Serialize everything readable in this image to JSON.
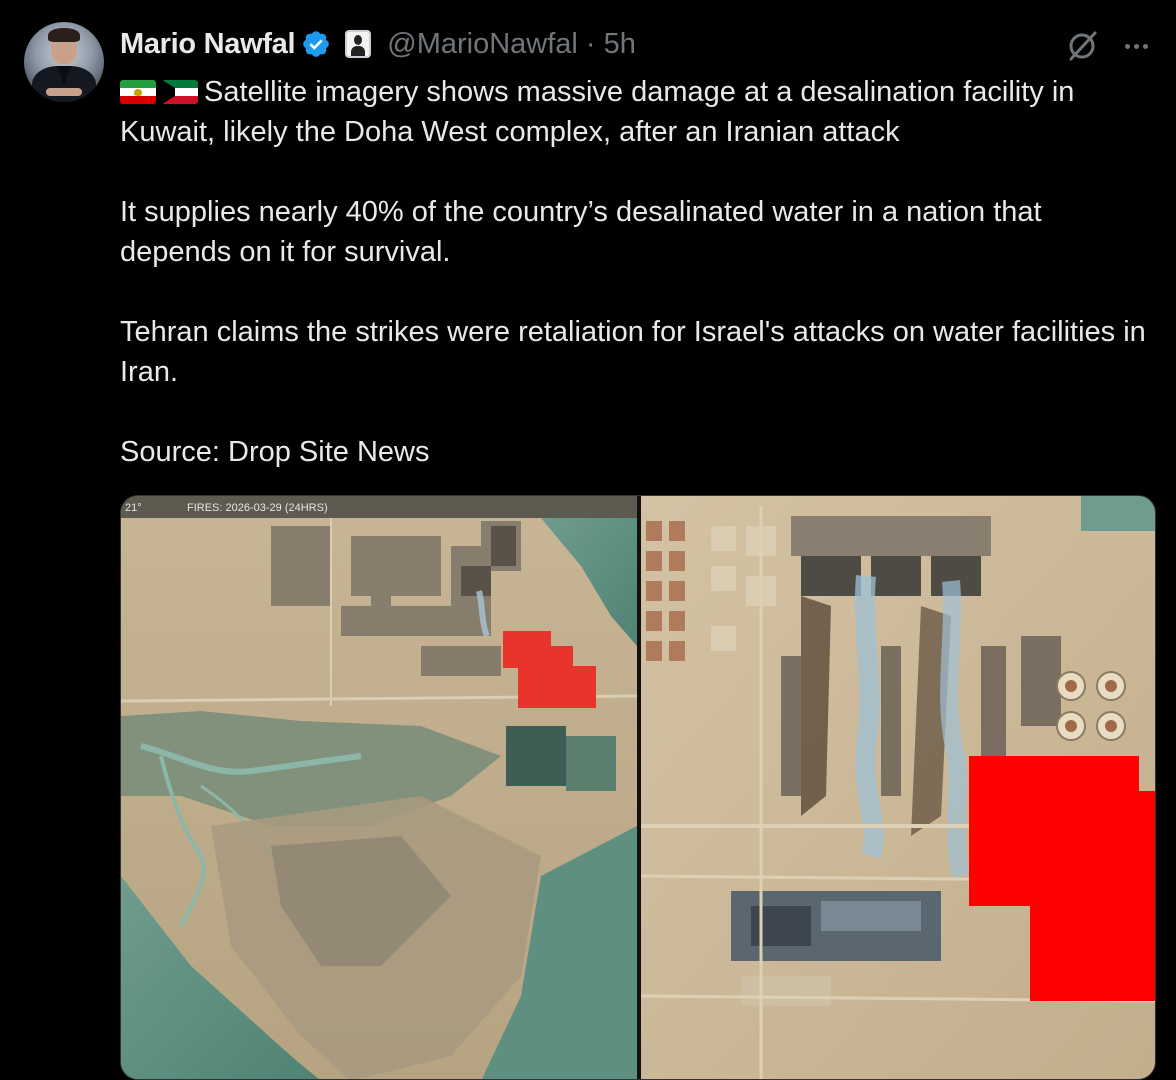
{
  "tweet": {
    "author_name": "Mario Nawfal",
    "handle": "@MarioNawfal",
    "separator": "·",
    "time": "5h",
    "icons": {
      "verified": "verified-badge-icon",
      "affiliate": "affiliate-badge-icon",
      "grok": "grok-icon",
      "more": "more-options-icon"
    },
    "flags": [
      "iran-flag",
      "kuwait-flag"
    ],
    "text": {
      "p1": "Satellite imagery shows massive damage at a desalination facility in Kuwait, likely the Doha West complex, after an Iranian attack",
      "p2": "It supplies nearly 40% of the country’s desalinated water in a nation that depends on it for survival.",
      "p3": "Tehran claims the strikes were retaliation for Israel's attacks on water facilities in Iran.",
      "p4": "Source: Drop Site News"
    },
    "media": {
      "left_image_caption_fragment": "21°",
      "left_image_caption": "FIRES: 2026-03-29 (24HRS)",
      "highlight_color": "#ff0000"
    }
  }
}
